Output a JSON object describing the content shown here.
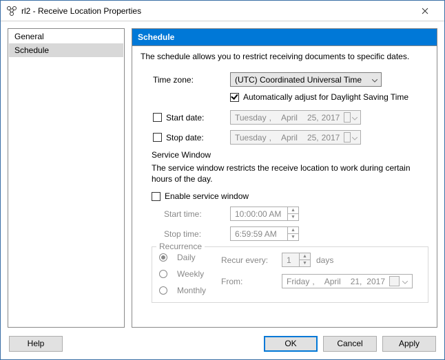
{
  "window": {
    "title": "rl2 - Receive Location Properties"
  },
  "sidebar": {
    "items": [
      {
        "label": "General"
      },
      {
        "label": "Schedule"
      }
    ],
    "selected": 1
  },
  "main": {
    "header": "Schedule",
    "description": "The schedule allows you to restrict receiving documents to specific dates.",
    "timezone": {
      "label": "Time zone:",
      "value": "(UTC) Coordinated Universal Time",
      "dst_label": "Automatically adjust for Daylight Saving Time",
      "dst_checked": true
    },
    "start_date": {
      "label": "Start date:",
      "checked": false,
      "weekday": "Tuesday",
      "sep": ",",
      "month": "April",
      "day": "25,",
      "year": "2017"
    },
    "stop_date": {
      "label": "Stop date:",
      "checked": false,
      "weekday": "Tuesday",
      "sep": ",",
      "month": "April",
      "day": "25,",
      "year": "2017"
    },
    "service_window": {
      "group_label": "Service Window",
      "group_desc": "The service window restricts the receive location to work during certain hours of the day.",
      "enable_label": "Enable service window",
      "enable_checked": false,
      "start_time_label": "Start time:",
      "start_time": "10:00:00 AM",
      "stop_time_label": "Stop time:",
      "stop_time": "6:59:59 AM"
    },
    "recurrence": {
      "legend": "Recurrence",
      "options": {
        "daily": "Daily",
        "weekly": "Weekly",
        "monthly": "Monthly"
      },
      "selected": "daily",
      "recur_label": "Recur every:",
      "recur_value": "1",
      "recur_unit": "days",
      "from_label": "From:",
      "from": {
        "weekday": "Friday",
        "sep": ",",
        "month": "April",
        "day": "21,",
        "year": "2017"
      }
    }
  },
  "footer": {
    "help": "Help",
    "ok": "OK",
    "cancel": "Cancel",
    "apply": "Apply"
  }
}
